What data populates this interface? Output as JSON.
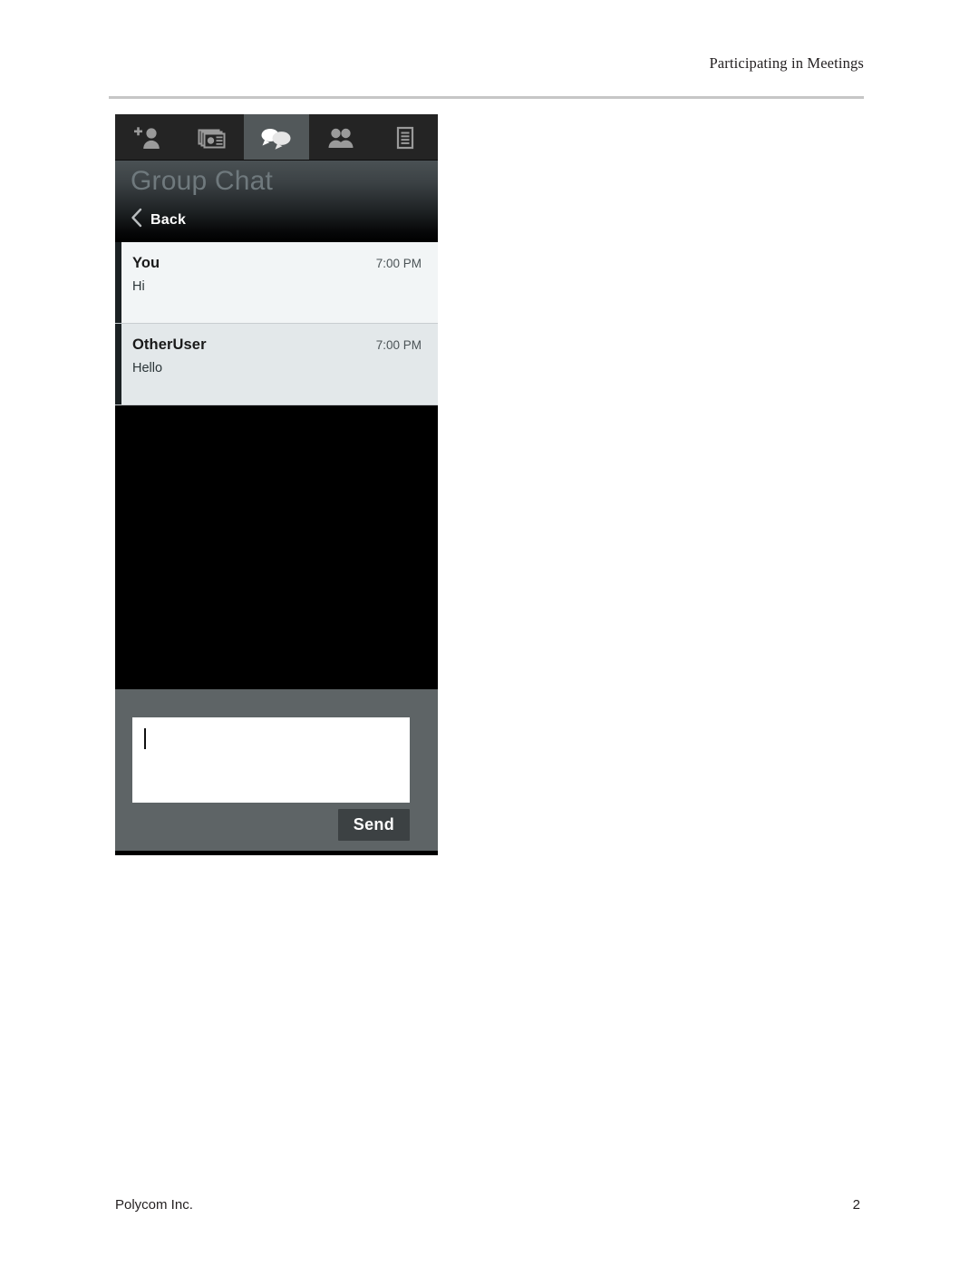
{
  "document": {
    "running_header": "Participating in Meetings",
    "footer_left": "Polycom Inc.",
    "footer_page_number": "2"
  },
  "app": {
    "toolbar": {
      "tabs": [
        {
          "name": "add-participant",
          "icon": "add-person-icon",
          "label": "",
          "selected": false
        },
        {
          "name": "content-share",
          "icon": "content-slides-icon",
          "label": "",
          "selected": false
        },
        {
          "name": "chat",
          "icon": "chat-bubbles-icon",
          "label": "",
          "selected": true
        },
        {
          "name": "participants",
          "icon": "people-icon",
          "label": "",
          "selected": false
        },
        {
          "name": "notes",
          "icon": "list-document-icon",
          "label": "",
          "selected": false
        }
      ]
    },
    "header": {
      "title": "Group Chat",
      "back_label": "Back",
      "back_icon": "chevron-left-icon"
    },
    "messages": [
      {
        "author": "You",
        "time": "7:00 PM",
        "text": "Hi"
      },
      {
        "author": "OtherUser",
        "time": "7:00 PM",
        "text": "Hello"
      }
    ],
    "composer": {
      "input_value": "",
      "input_placeholder": "",
      "send_label": "Send"
    },
    "colors": {
      "tabbar_bg": "#242424",
      "tab_selected_bg": "#52585a",
      "panel_bg": "#000000",
      "composer_bg": "#5e6466",
      "send_button_bg": "#3c4143",
      "message_row_a": "#f2f5f6",
      "message_row_b": "#e3e8ea",
      "title_text": "#6f797d"
    }
  }
}
